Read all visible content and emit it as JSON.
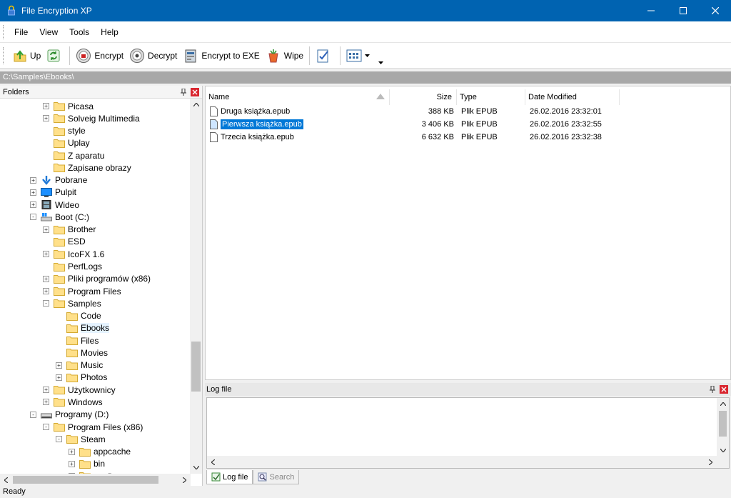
{
  "window": {
    "title": "File Encryption XP",
    "controls": [
      "minimize",
      "maximize",
      "close"
    ]
  },
  "menu": {
    "items": [
      "File",
      "View",
      "Tools",
      "Help"
    ]
  },
  "toolbar": {
    "up_label": "Up",
    "refresh_icon": "refresh-icon",
    "encrypt_label": "Encrypt",
    "decrypt_label": "Decrypt",
    "encrypt_exe_label": "Encrypt to EXE",
    "wipe_label": "Wipe"
  },
  "path": "C:\\Samples\\Ebooks\\",
  "folders_panel": {
    "title": "Folders",
    "items": [
      {
        "label": "Picasa",
        "expander": "+",
        "icon": "folder"
      },
      {
        "label": "Solveig Multimedia",
        "expander": "+",
        "icon": "folder"
      },
      {
        "label": "style",
        "expander": "",
        "icon": "folder"
      },
      {
        "label": "Uplay",
        "expander": "",
        "icon": "folder"
      },
      {
        "label": "Z aparatu",
        "expander": "",
        "icon": "folder"
      },
      {
        "label": "Zapisane obrazy",
        "expander": "",
        "icon": "folder"
      },
      {
        "label": "Pobrane",
        "expander": "+",
        "icon": "download"
      },
      {
        "label": "Pulpit",
        "expander": "+",
        "icon": "desktop"
      },
      {
        "label": "Wideo",
        "expander": "+",
        "icon": "video"
      },
      {
        "label": "Boot (C:)",
        "expander": "-",
        "icon": "drive-windows"
      },
      {
        "label": "Brother",
        "expander": "+",
        "icon": "folder"
      },
      {
        "label": "ESD",
        "expander": "",
        "icon": "folder"
      },
      {
        "label": "IcoFX 1.6",
        "expander": "+",
        "icon": "folder"
      },
      {
        "label": "PerfLogs",
        "expander": "",
        "icon": "folder"
      },
      {
        "label": "Pliki programów (x86)",
        "expander": "+",
        "icon": "folder"
      },
      {
        "label": "Program Files",
        "expander": "+",
        "icon": "folder"
      },
      {
        "label": "Samples",
        "expander": "-",
        "icon": "folder"
      },
      {
        "label": "Code",
        "expander": "",
        "icon": "folder"
      },
      {
        "label": "Ebooks",
        "expander": "",
        "icon": "folder",
        "selected": true
      },
      {
        "label": "Files",
        "expander": "",
        "icon": "folder"
      },
      {
        "label": "Movies",
        "expander": "",
        "icon": "folder"
      },
      {
        "label": "Music",
        "expander": "+",
        "icon": "folder"
      },
      {
        "label": "Photos",
        "expander": "+",
        "icon": "folder"
      },
      {
        "label": "Użytkownicy",
        "expander": "+",
        "icon": "folder"
      },
      {
        "label": "Windows",
        "expander": "+",
        "icon": "folder"
      },
      {
        "label": "Programy (D:)",
        "expander": "-",
        "icon": "drive"
      },
      {
        "label": "Program Files (x86)",
        "expander": "-",
        "icon": "folder"
      },
      {
        "label": "Steam",
        "expander": "-",
        "icon": "folder"
      },
      {
        "label": "appcache",
        "expander": "+",
        "icon": "folder"
      },
      {
        "label": "bin",
        "expander": "+",
        "icon": "folder"
      },
      {
        "label": "config",
        "expander": "+",
        "icon": "folder"
      }
    ]
  },
  "files_panel": {
    "columns": {
      "name": "Name",
      "size": "Size",
      "type": "Type",
      "date": "Date Modified"
    },
    "rows": [
      {
        "name": "Druga książka.epub",
        "size": "388 KB",
        "type": "Plik EPUB",
        "date": "26.02.2016 23:32:01"
      },
      {
        "name": "Pierwsza książka.epub",
        "size": "3 406 KB",
        "type": "Plik EPUB",
        "date": "26.02.2016 23:32:55",
        "selected": true
      },
      {
        "name": "Trzecia książka.epub",
        "size": "6 632 KB",
        "type": "Plik EPUB",
        "date": "26.02.2016 23:32:38"
      }
    ]
  },
  "log_panel": {
    "title": "Log file",
    "tabs": [
      {
        "label": "Log file",
        "active": true
      },
      {
        "label": "Search",
        "active": false
      }
    ]
  },
  "status": "Ready"
}
